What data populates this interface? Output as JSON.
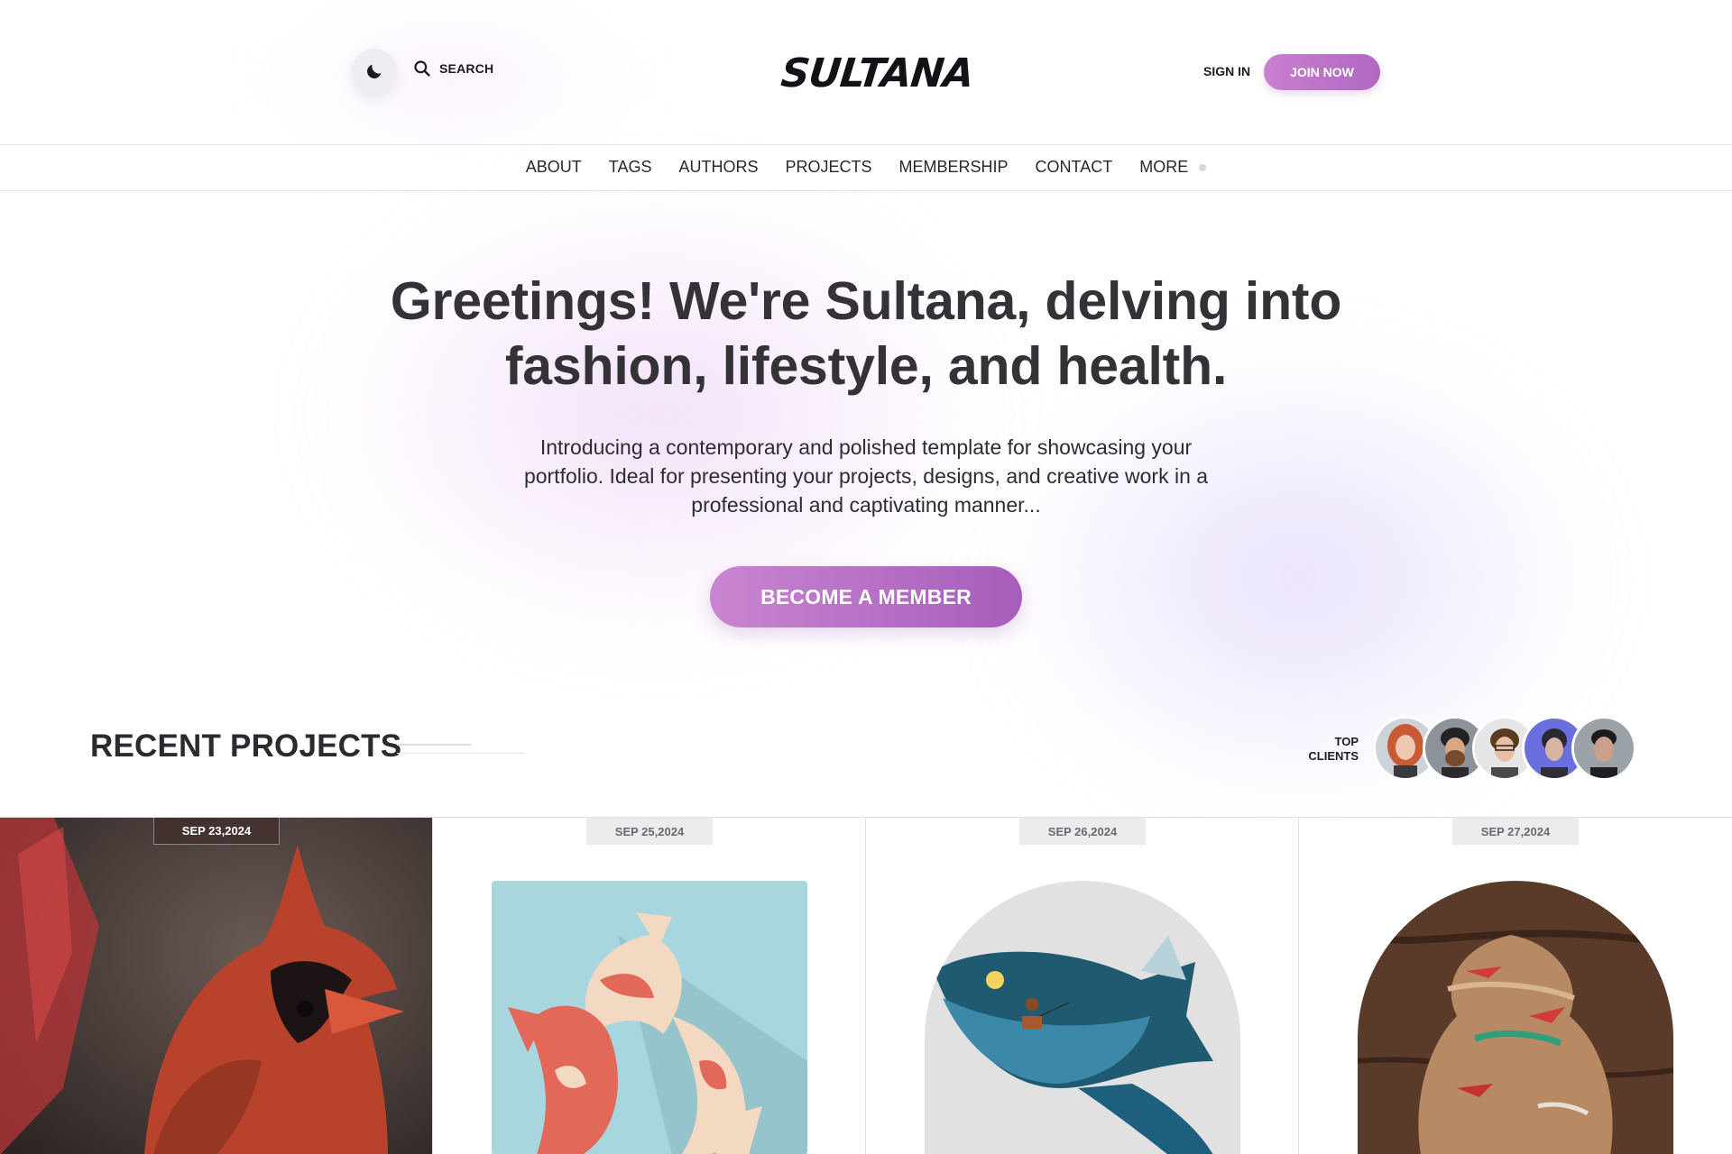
{
  "header": {
    "search_label": "SEARCH",
    "logo_text": "SULTANA",
    "signin_label": "SIGN IN",
    "join_label": "JOIN NOW",
    "icons": [
      "moon-icon",
      "search-icon"
    ]
  },
  "nav": {
    "items": [
      "ABOUT",
      "TAGS",
      "AUTHORS",
      "PROJECTS",
      "MEMBERSHIP",
      "CONTACT",
      "MORE"
    ]
  },
  "hero": {
    "title_line1": "Greetings! We're Sultana, delving into",
    "title_line2": "fashion, lifestyle, and health.",
    "subtitle_line1": "Introducing a contemporary and polished template for showcasing your",
    "subtitle_line2": "portfolio. Ideal for presenting your projects, designs, and creative work in a",
    "subtitle_line3": "professional and captivating manner...",
    "cta_label": "BECOME A MEMBER"
  },
  "recent": {
    "title": "RECENT PROJECTS",
    "clients_label_line1": "TOP",
    "clients_label_line2": "CLIENTS",
    "avatar_count": 5
  },
  "projects": [
    {
      "date": "SEP 23,2024"
    },
    {
      "date": "SEP 25,2024"
    },
    {
      "date": "SEP 26,2024"
    },
    {
      "date": "SEP 27,2024"
    }
  ],
  "colors": {
    "accent": "#b86fc8",
    "text": "#2c2a2e"
  }
}
